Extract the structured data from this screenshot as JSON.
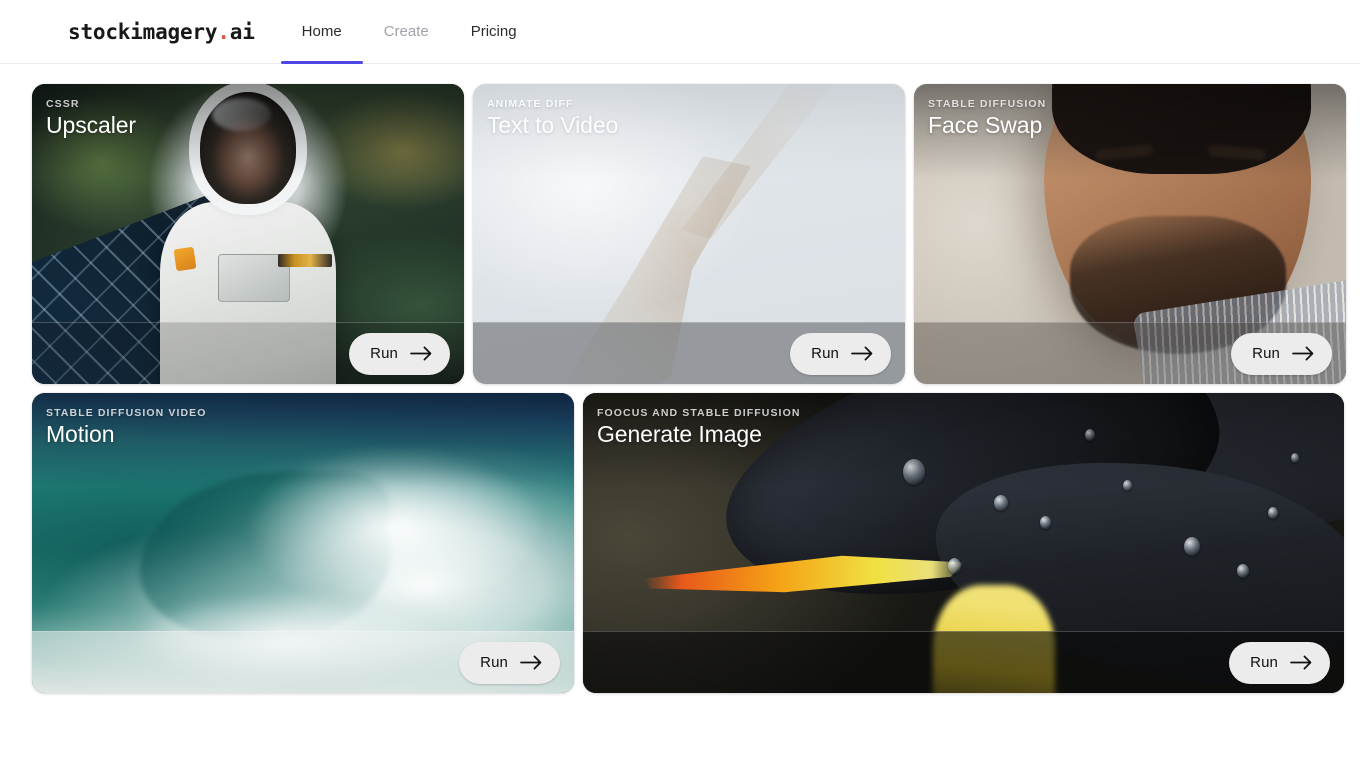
{
  "header": {
    "brand": {
      "name": "stockimagery",
      "dot": ".",
      "suffix": "ai"
    },
    "nav": [
      {
        "label": "Home",
        "state": "active"
      },
      {
        "label": "Create",
        "state": "disabled"
      },
      {
        "label": "Pricing",
        "state": "default"
      }
    ]
  },
  "colors": {
    "accent": "#4f46e5",
    "brand_dot": "#e2574c",
    "text_primary": "#18181b",
    "text_muted": "#a1a1a9",
    "page_background": "#ffffff",
    "run_button_bg": "#ececed"
  },
  "cards": [
    {
      "id": "upscaler",
      "eyebrow": "CSSR",
      "title": "Upscaler",
      "run_label": "Run",
      "run_icon": "arrow-right-icon"
    },
    {
      "id": "text-to-video",
      "eyebrow": "ANIMATE DIFF",
      "title": "Text to Video",
      "run_label": "Run",
      "run_icon": "arrow-right-icon"
    },
    {
      "id": "face-swap",
      "eyebrow": "STABLE DIFFUSION",
      "title": "Face Swap",
      "run_label": "Run",
      "run_icon": "arrow-right-icon"
    },
    {
      "id": "motion",
      "eyebrow": "STABLE DIFFUSION VIDEO",
      "title": "Motion",
      "run_label": "Run",
      "run_icon": "arrow-right-icon"
    },
    {
      "id": "generate-image",
      "eyebrow": "FOOCUS AND STABLE DIFFUSION",
      "title": "Generate Image",
      "run_label": "Run",
      "run_icon": "arrow-right-icon"
    }
  ]
}
